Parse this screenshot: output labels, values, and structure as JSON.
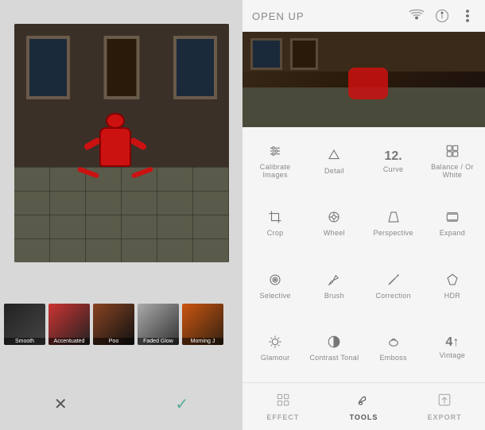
{
  "left": {
    "thumbnails": [
      {
        "label": "Smooth"
      },
      {
        "label": "Accentuated"
      },
      {
        "label": "Poo"
      },
      {
        "label": "Faded Glow"
      },
      {
        "label": "Morning J"
      }
    ],
    "actions": {
      "cancel": "✕",
      "confirm": "✓"
    }
  },
  "right": {
    "header": {
      "title": "OPEN UP",
      "icons": [
        "signal",
        "info",
        "more"
      ]
    },
    "tools": [
      {
        "id": "calibrate",
        "label": "Calibrate Images",
        "icon": "sliders"
      },
      {
        "id": "detail",
        "label": "Detail",
        "icon": "triangle"
      },
      {
        "id": "curve",
        "label": "Curve",
        "icon": "12"
      },
      {
        "id": "balance",
        "label": "Balance / Or White",
        "icon": "balance"
      },
      {
        "id": "crop",
        "label": "Crop",
        "icon": "crop"
      },
      {
        "id": "wheel",
        "label": "Wheel",
        "icon": "wheel"
      },
      {
        "id": "perspective",
        "label": "Perspective",
        "icon": "perspective"
      },
      {
        "id": "expand",
        "label": "Expand",
        "icon": "expand"
      },
      {
        "id": "selective",
        "label": "Selective",
        "icon": "selective"
      },
      {
        "id": "brush",
        "label": "Brush",
        "icon": "brush"
      },
      {
        "id": "correction",
        "label": "Correction",
        "icon": "correction"
      },
      {
        "id": "hdr",
        "label": "HDR",
        "icon": "hdr"
      },
      {
        "id": "glamour",
        "label": "Glamour",
        "icon": "glamour"
      },
      {
        "id": "contrast",
        "label": "Contrast Tonal",
        "icon": "contrast"
      },
      {
        "id": "emboss",
        "label": "Emboss",
        "icon": "emboss"
      },
      {
        "id": "vintage",
        "label": "Vintage",
        "icon": "vintage"
      }
    ],
    "bottom_nav": [
      {
        "id": "effect",
        "label": "EFFECT",
        "icon": "grid"
      },
      {
        "id": "tools",
        "label": "TOOLS",
        "icon": "mustache",
        "active": true
      },
      {
        "id": "export",
        "label": "EXPORT",
        "icon": "export"
      }
    ]
  }
}
